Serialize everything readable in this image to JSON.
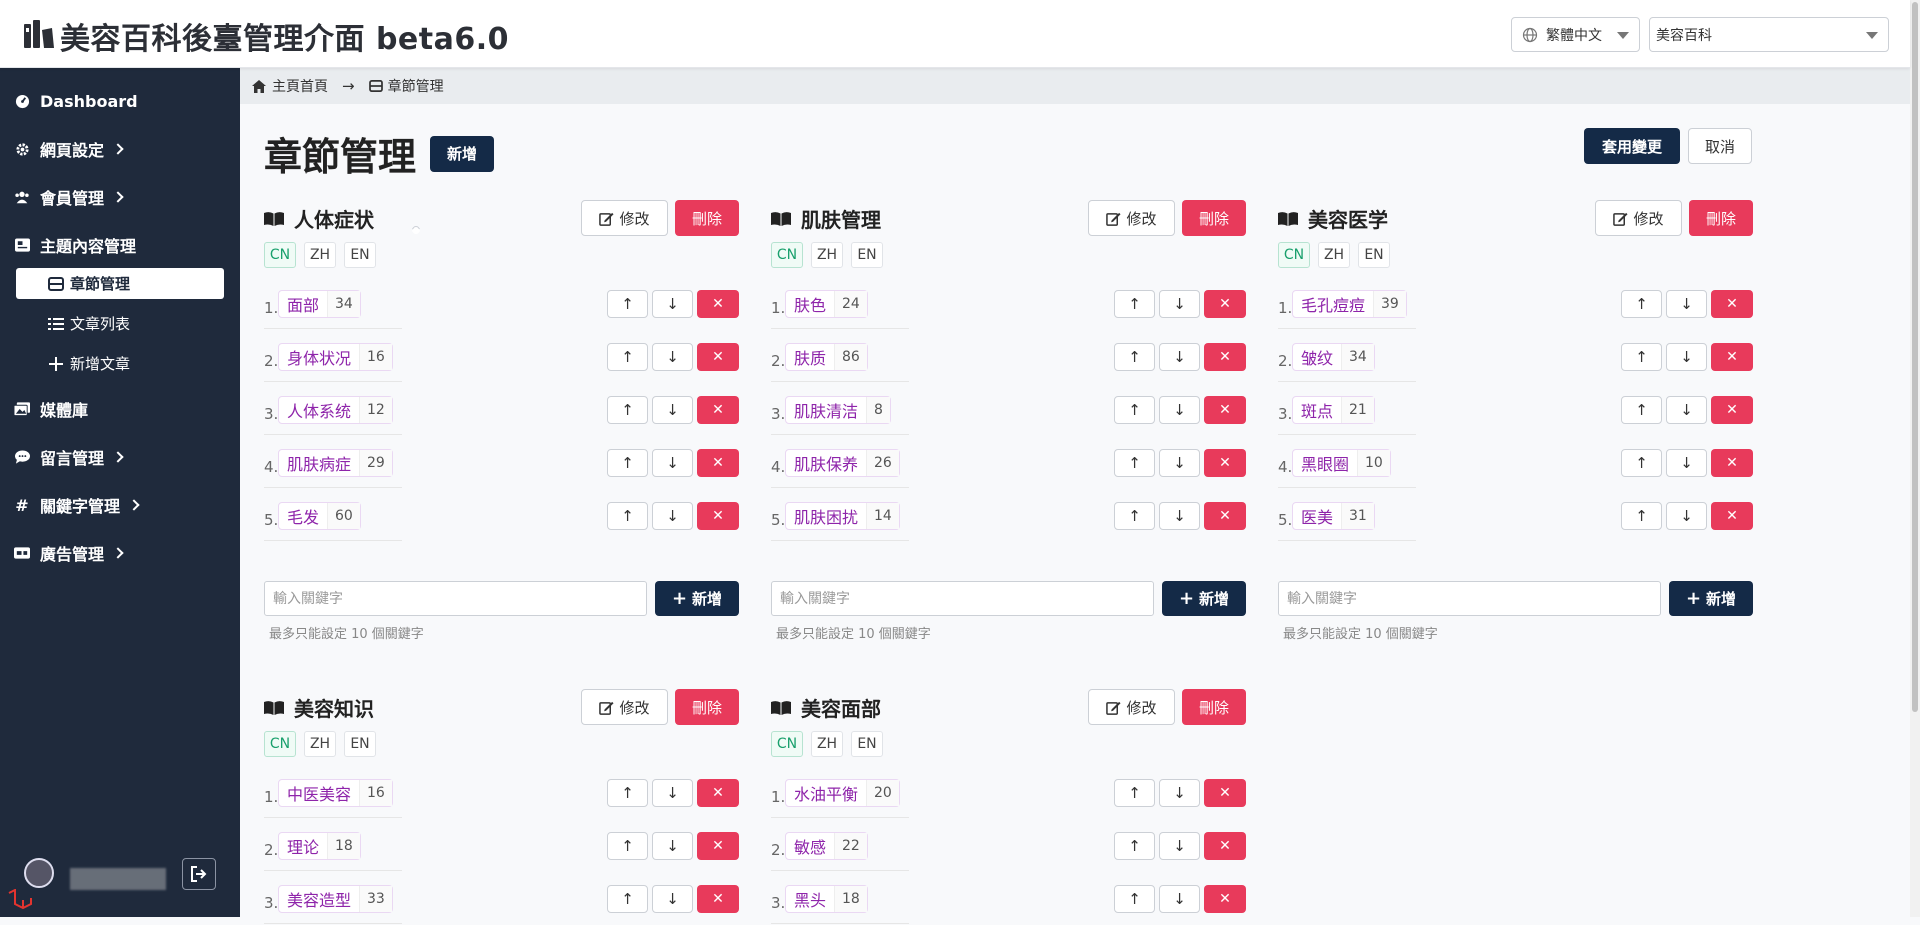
{
  "app": {
    "title": "美容百科後臺管理介面 beta6.0"
  },
  "header": {
    "language": "繁體中文",
    "site": "美容百科"
  },
  "sidebar": {
    "items": [
      {
        "label": "Dashboard"
      },
      {
        "label": "網頁設定"
      },
      {
        "label": "會員管理"
      },
      {
        "label": "主題內容管理"
      },
      {
        "label": "媒體庫"
      },
      {
        "label": "留言管理"
      },
      {
        "label": "關鍵字管理"
      },
      {
        "label": "廣告管理"
      }
    ],
    "subitems": [
      {
        "label": "章節管理"
      },
      {
        "label": "文章列表"
      },
      {
        "label": "新增文章"
      }
    ]
  },
  "breadcrumb": {
    "home": "主頁首頁",
    "current": "章節管理"
  },
  "page": {
    "title": "章節管理",
    "add_label": "新增",
    "apply_label": "套用變更",
    "cancel_label": "取消"
  },
  "card_labels": {
    "edit": "修改",
    "delete": "刪除",
    "langs": [
      "CN",
      "ZH",
      "EN"
    ],
    "input_placeholder": "輸入關鍵字",
    "add": "新增",
    "hint": "最多只能設定 10 個關鍵字"
  },
  "sections": [
    {
      "title": "人体症状",
      "tags": [
        {
          "no": "1.",
          "name": "面部",
          "count": "34"
        },
        {
          "no": "2.",
          "name": "身体状况",
          "count": "16"
        },
        {
          "no": "3.",
          "name": "人体系统",
          "count": "12"
        },
        {
          "no": "4.",
          "name": "肌肤病症",
          "count": "29"
        },
        {
          "no": "5.",
          "name": "毛发",
          "count": "60"
        }
      ]
    },
    {
      "title": "肌肤管理",
      "tags": [
        {
          "no": "1.",
          "name": "肤色",
          "count": "24"
        },
        {
          "no": "2.",
          "name": "肤质",
          "count": "86"
        },
        {
          "no": "3.",
          "name": "肌肤清洁",
          "count": "8"
        },
        {
          "no": "4.",
          "name": "肌肤保养",
          "count": "26"
        },
        {
          "no": "5.",
          "name": "肌肤困扰",
          "count": "14"
        }
      ]
    },
    {
      "title": "美容医学",
      "tags": [
        {
          "no": "1.",
          "name": "毛孔痘痘",
          "count": "39"
        },
        {
          "no": "2.",
          "name": "皱纹",
          "count": "34"
        },
        {
          "no": "3.",
          "name": "斑点",
          "count": "21"
        },
        {
          "no": "4.",
          "name": "黑眼圈",
          "count": "10"
        },
        {
          "no": "5.",
          "name": "医美",
          "count": "31"
        }
      ]
    },
    {
      "title": "美容知识",
      "tags": [
        {
          "no": "1.",
          "name": "中医美容",
          "count": "16"
        },
        {
          "no": "2.",
          "name": "理论",
          "count": "18"
        },
        {
          "no": "3.",
          "name": "美容造型",
          "count": "33"
        }
      ]
    },
    {
      "title": "美容面部",
      "tags": [
        {
          "no": "1.",
          "name": "水油平衡",
          "count": "20"
        },
        {
          "no": "2.",
          "name": "敏感",
          "count": "22"
        },
        {
          "no": "3.",
          "name": "黑头",
          "count": "18"
        }
      ]
    }
  ],
  "colors": {
    "sidebar": "#1f2a3c",
    "primary": "#142a47",
    "danger": "#e83a5b",
    "tag_text": "#8e24aa",
    "lang_active": "#1aa06d"
  }
}
